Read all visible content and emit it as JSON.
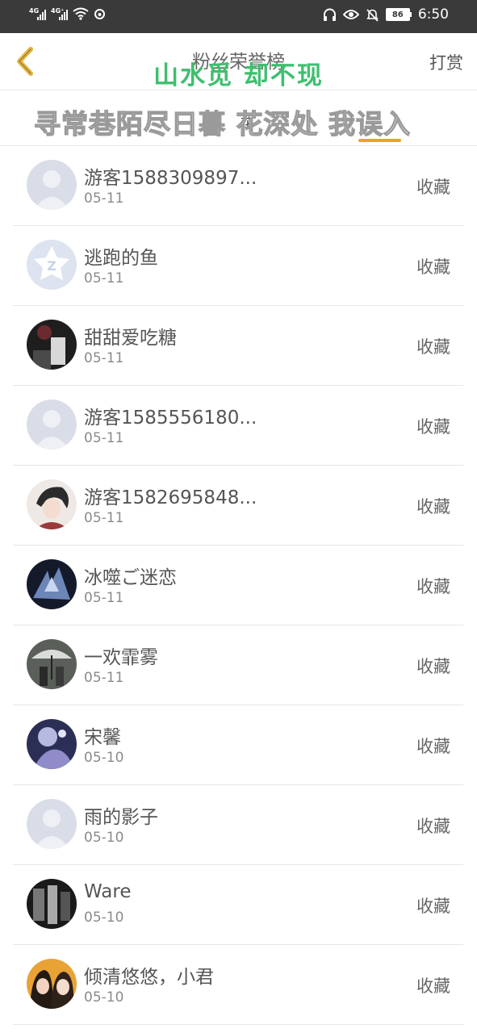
{
  "status_bar": {
    "sim1_tag": "4G",
    "sim2_tag": "4G⁺",
    "battery": "86",
    "time": "6:50",
    "icons": [
      "signal-icon",
      "wifi-icon",
      "sync-icon",
      "headphones-icon",
      "eye-icon",
      "bell-off-icon",
      "battery-icon"
    ]
  },
  "header": {
    "title": "粉丝荣誉榜",
    "overlay_text": "山水觅 却不现",
    "reward_label": "打赏"
  },
  "tabs": {
    "small_label": "花",
    "overlay_text": "寻常巷陌尽日暮 花深处  我误入",
    "accent_color": "#f0a318"
  },
  "list": {
    "collect_label": "收藏",
    "items": [
      {
        "name": "游客1588309897...",
        "date": "05-11",
        "avatar": "default-avatar"
      },
      {
        "name": "逃跑的鱼",
        "date": "05-11",
        "avatar": "qq-avatar"
      },
      {
        "name": "甜甜爱吃糖",
        "date": "05-11",
        "avatar": "photo-avatar"
      },
      {
        "name": "游客1585556180...",
        "date": "05-11",
        "avatar": "default-avatar"
      },
      {
        "name": "游客1582695848...",
        "date": "05-11",
        "avatar": "photo-avatar"
      },
      {
        "name": "冰噬ご迷恋",
        "date": "05-11",
        "avatar": "photo-avatar"
      },
      {
        "name": "一欢霏雾",
        "date": "05-11",
        "avatar": "photo-avatar"
      },
      {
        "name": "宋馨",
        "date": "05-10",
        "avatar": "photo-avatar"
      },
      {
        "name": "雨的影子",
        "date": "05-10",
        "avatar": "default-avatar"
      },
      {
        "name": "Ware",
        "date": "05-10",
        "avatar": "photo-avatar"
      },
      {
        "name": "倾清悠悠，小君",
        "date": "05-10",
        "avatar": "photo-avatar"
      }
    ]
  }
}
